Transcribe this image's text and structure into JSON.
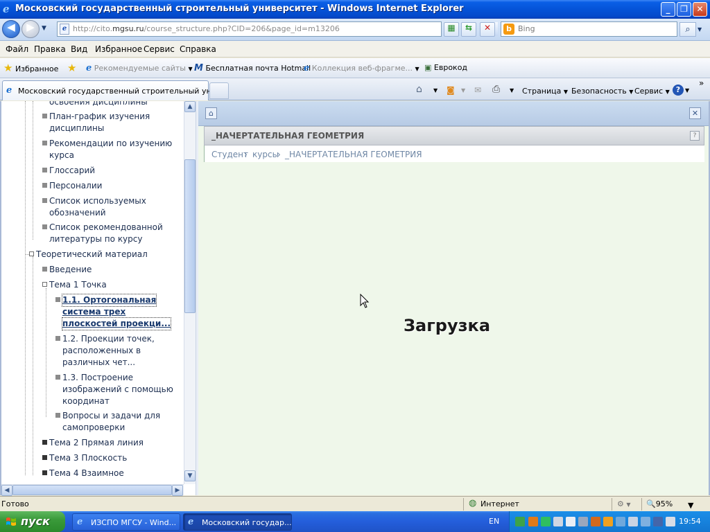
{
  "window": {
    "title": "Московский государственный строительный университет - Windows Internet Explorer",
    "min_glyph": "_",
    "max_glyph": "❐",
    "close_glyph": "✕"
  },
  "address": {
    "url_prefix": "http://cito.",
    "url_domain": "mgsu.ru",
    "url_rest": "/course_structure.php?CID=206&page_id=m13206",
    "search_placeholder": "Bing"
  },
  "menu": {
    "items": [
      "Файл",
      "Правка",
      "Вид",
      "Избранное",
      "Сервис",
      "Справка"
    ]
  },
  "favorites": {
    "label": "Избранное",
    "links": [
      "Рекомендуемые сайты",
      "Бесплатная почта Hotmail",
      "Коллекция веб-фрагме...",
      "Еврокод"
    ]
  },
  "tabs": {
    "active_label": "Московский государственный строительный унив..."
  },
  "commandbar": {
    "page": "Страница",
    "safety": "Безопасность",
    "tools": "Сервис",
    "help_glyph": "?",
    "chevron": "»"
  },
  "tree": {
    "items": [
      "освоения дисциплины",
      "План-график изучения",
      "дисциплины",
      "Рекомендации по изучению",
      "курса",
      "Глоссарий",
      "Персоналии",
      "Список используемых",
      "обозначений",
      "Список рекомендованной",
      "литературы по курсу",
      "Теоретический материал",
      "Введение",
      "Тема 1 Точка",
      "1.1. Ортогональная",
      "система трех",
      "плоскостей проекци...",
      "1.2. Проекции точек,",
      "расположенных в",
      "различных чет...",
      "1.3. Построение",
      "изображений с помощью",
      "координат",
      "Вопросы и задачи для",
      "самопроверки",
      "Тема 2 Прямая линия",
      "Тема 3 Плоскость",
      "Тема 4 Взаимное"
    ]
  },
  "content": {
    "course_title": "_НАЧЕРТАТЕЛЬНАЯ ГЕОМЕТРИЯ",
    "breadcrumb": [
      "Студент",
      "курсы",
      "_НАЧЕРТАТЕЛЬНАЯ ГЕОМЕТРИЯ"
    ],
    "crumb_sep": "›",
    "loading": "Загрузка",
    "help_glyph": "?",
    "close_glyph": "✕",
    "home_glyph": "⌂"
  },
  "status": {
    "left": "Готово",
    "zone": "Интернет",
    "zoom": "95%"
  },
  "taskbar": {
    "start": "пуск",
    "tasks": [
      "ИЗСПО МГСУ - Wind...",
      "Московский государ..."
    ],
    "lang": "EN",
    "clock": "19:54"
  },
  "colors": {
    "titlebar": "#0553d8",
    "content_bg": "#eff7ea",
    "tree_text": "#1b2d4f",
    "crumb_text": "#6f87a5",
    "start_green": "#3a9a3a"
  }
}
